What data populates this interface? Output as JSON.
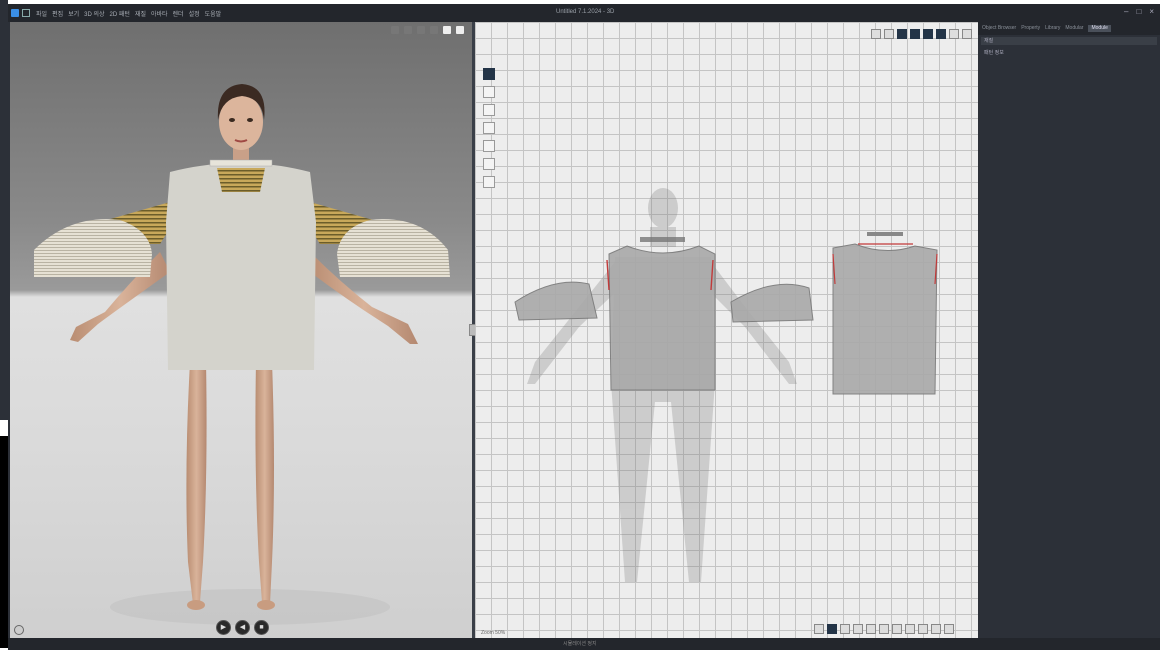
{
  "titlebar": {
    "menus": [
      "파일",
      "편집",
      "보기",
      "3D 의상",
      "2D 패턴",
      "재질",
      "아바타",
      "렌더",
      "설정",
      "도움말"
    ],
    "doc_title": "Untitled 7.1.2024 - 3D",
    "window_controls": [
      "–",
      "□",
      "×"
    ]
  },
  "viewport3d": {
    "play_buttons": [
      "▶",
      "◀",
      "■"
    ]
  },
  "viewport2d": {
    "label": "Zoom 50%"
  },
  "right_panel": {
    "tabs": [
      "Object Browser",
      "Property",
      "Library",
      "Modular",
      "Module"
    ],
    "active_tab": 4,
    "row": "재질",
    "item": "패턴 정보"
  },
  "status": {
    "text": "시뮬레이션 정지"
  },
  "colors": {
    "accent": "#233447",
    "panel": "#2c3038",
    "grid": "#c4c4c4",
    "fabric": "#d3d1c8",
    "stripe": "#b89a42"
  }
}
